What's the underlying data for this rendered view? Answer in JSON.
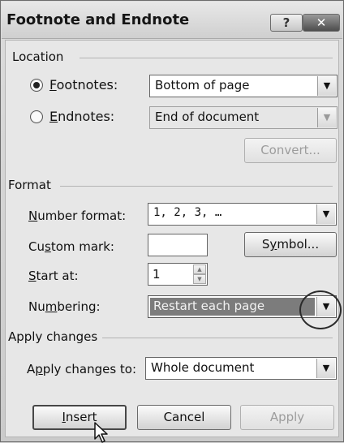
{
  "dialog": {
    "title": "Footnote and Endnote",
    "help_label": "?",
    "close_label": "✕"
  },
  "location": {
    "section_label": "Location",
    "footnotes": {
      "label_prefix": "",
      "mnemonic": "F",
      "label_rest": "ootnotes:",
      "selected": true,
      "value": "Bottom of page"
    },
    "endnotes": {
      "label_prefix": "",
      "mnemonic": "E",
      "label_rest": "ndnotes:",
      "selected": false,
      "value": "End of document"
    },
    "convert_label": "Convert..."
  },
  "format": {
    "section_label": "Format",
    "number_format": {
      "label_prefix": "",
      "mnemonic": "N",
      "label_rest": "umber format:",
      "value": "1, 2, 3, …"
    },
    "custom_mark": {
      "label_prefix": "Cu",
      "mnemonic": "s",
      "label_rest": "tom mark:",
      "value": ""
    },
    "symbol_button": {
      "label_prefix": "S",
      "mnemonic": "y",
      "label_rest": "mbol..."
    },
    "start_at": {
      "label_prefix": "",
      "mnemonic": "S",
      "label_rest": "tart at:",
      "value": "1"
    },
    "numbering": {
      "label_prefix": "Nu",
      "mnemonic": "m",
      "label_rest": "bering:",
      "value": "Restart each page"
    }
  },
  "apply": {
    "section_label": "Apply changes",
    "apply_to": {
      "label_prefix": "A",
      "mnemonic": "p",
      "label_rest": "ply changes to:",
      "value": "Whole document"
    }
  },
  "buttons": {
    "insert": {
      "label_prefix": "",
      "mnemonic": "I",
      "label_rest": "nsert"
    },
    "cancel": "Cancel",
    "apply": "Apply"
  }
}
